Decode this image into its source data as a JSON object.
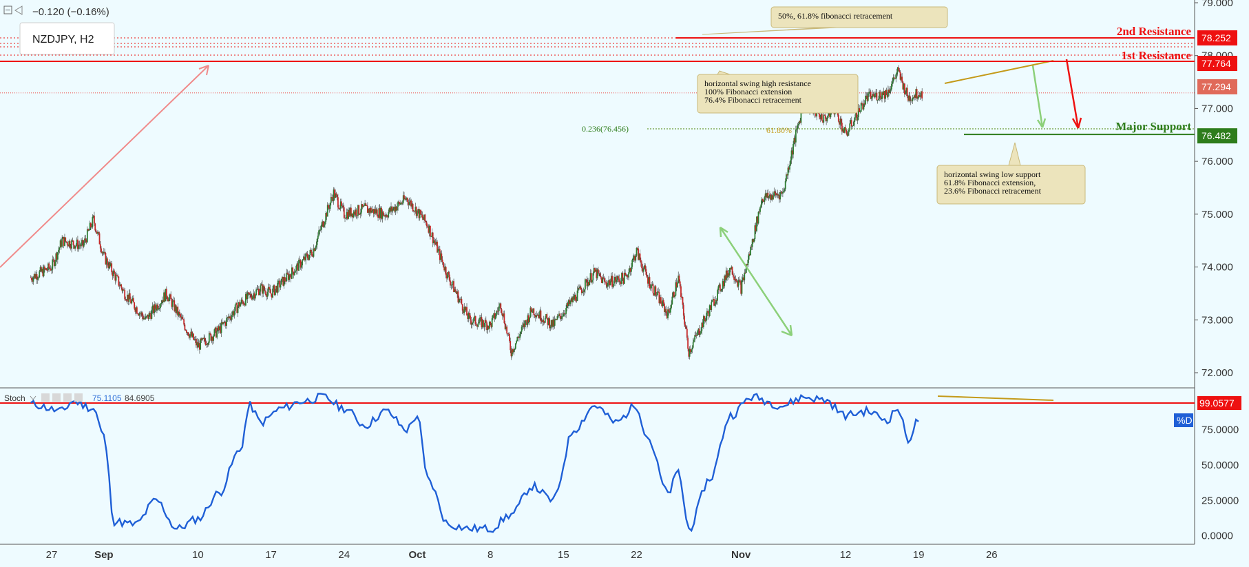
{
  "header": {
    "symbol": "NZDJPY, H2",
    "change": "−0.120 (−0.16%)"
  },
  "stochastic": {
    "title": "Stoch",
    "value_k": "75.1105",
    "value_d": "84.6905",
    "d_label": "%D",
    "level_label": "99.0577",
    "level_value": 99.0577
  },
  "annotations": {
    "fib_top": "50%, 61.8% fibonacci retracement",
    "swing_high": [
      "horizontal swing high resistance",
      "100% Fibonacci extension",
      "76.4% Fibonacci retracement"
    ],
    "swing_low": [
      "horizontal swing low support",
      "61.8% Fibonacci extension,",
      "23.6% Fibonacci retracement"
    ],
    "fib_236": "0.236(76.456)",
    "fib_618": "61.80%"
  },
  "levels": {
    "second_resistance": {
      "label": "2nd Resistance",
      "price": "78.252",
      "value": 78.252
    },
    "first_resistance": {
      "label": "1st Resistance",
      "price": "77.764",
      "value": 77.764
    },
    "current": {
      "price": "77.294",
      "value": 77.294
    },
    "major_support": {
      "label": "Major Support",
      "price": "76.482",
      "value": 76.482
    }
  },
  "colors": {
    "background": "#eefbff",
    "resistance": "#ee1111",
    "support": "#2e7d1c",
    "candle_up": "#2e7d32",
    "candle_down": "#c62828",
    "stoch_line": "#1f5fd6",
    "annotation_fill": "#ece4bc",
    "trend_arrow": "#f08a8a",
    "green_arrow": "#8cd07a",
    "gold_line": "#c49a1a"
  },
  "chart_data": {
    "type": "candlestick",
    "symbol": "NZDJPY",
    "timeframe": "H2",
    "y_ticks": [
      "72.000",
      "73.000",
      "74.000",
      "75.000",
      "76.000",
      "77.000",
      "78.000",
      "79.000"
    ],
    "ylim": [
      71.7,
      79.0
    ],
    "x_ticks": [
      "27",
      "Sep",
      "10",
      "17",
      "24",
      "Oct",
      "8",
      "15",
      "22",
      "Nov",
      "12",
      "19",
      "26"
    ],
    "x_tick_days": [
      0,
      5,
      14,
      21,
      28,
      35,
      42,
      49,
      56,
      66,
      76,
      83,
      90
    ],
    "close_path": [
      {
        "day": -2,
        "close": 73.8
      },
      {
        "day": 0,
        "close": 74.0
      },
      {
        "day": 1,
        "close": 74.5
      },
      {
        "day": 3,
        "close": 74.4
      },
      {
        "day": 4,
        "close": 74.9
      },
      {
        "day": 5,
        "close": 74.2
      },
      {
        "day": 7,
        "close": 73.5
      },
      {
        "day": 9,
        "close": 73.0
      },
      {
        "day": 11,
        "close": 73.5
      },
      {
        "day": 13,
        "close": 72.8
      },
      {
        "day": 14,
        "close": 72.5
      },
      {
        "day": 16,
        "close": 72.8
      },
      {
        "day": 18,
        "close": 73.3
      },
      {
        "day": 20,
        "close": 73.6
      },
      {
        "day": 21,
        "close": 73.5
      },
      {
        "day": 23,
        "close": 73.9
      },
      {
        "day": 25,
        "close": 74.3
      },
      {
        "day": 27,
        "close": 75.4
      },
      {
        "day": 28,
        "close": 75.0
      },
      {
        "day": 30,
        "close": 75.1
      },
      {
        "day": 32,
        "close": 75.0
      },
      {
        "day": 34,
        "close": 75.3
      },
      {
        "day": 36,
        "close": 74.8
      },
      {
        "day": 38,
        "close": 73.8
      },
      {
        "day": 40,
        "close": 73.0
      },
      {
        "day": 42,
        "close": 72.9
      },
      {
        "day": 43,
        "close": 73.3
      },
      {
        "day": 44,
        "close": 72.4
      },
      {
        "day": 46,
        "close": 73.2
      },
      {
        "day": 48,
        "close": 72.9
      },
      {
        "day": 50,
        "close": 73.4
      },
      {
        "day": 52,
        "close": 73.9
      },
      {
        "day": 53,
        "close": 73.7
      },
      {
        "day": 55,
        "close": 73.8
      },
      {
        "day": 56,
        "close": 74.3
      },
      {
        "day": 57,
        "close": 73.8
      },
      {
        "day": 59,
        "close": 73.1
      },
      {
        "day": 60,
        "close": 73.8
      },
      {
        "day": 61,
        "close": 72.4
      },
      {
        "day": 63,
        "close": 73.2
      },
      {
        "day": 65,
        "close": 74.0
      },
      {
        "day": 66,
        "close": 73.6
      },
      {
        "day": 67,
        "close": 74.4
      },
      {
        "day": 68,
        "close": 75.3
      },
      {
        "day": 70,
        "close": 75.4
      },
      {
        "day": 71,
        "close": 76.3
      },
      {
        "day": 72,
        "close": 77.1
      },
      {
        "day": 74,
        "close": 76.8
      },
      {
        "day": 75,
        "close": 77.0
      },
      {
        "day": 76,
        "close": 76.5
      },
      {
        "day": 78,
        "close": 77.2
      },
      {
        "day": 80,
        "close": 77.3
      },
      {
        "day": 81,
        "close": 77.7
      },
      {
        "day": 82,
        "close": 77.2
      },
      {
        "day": 83,
        "close": 77.294
      }
    ],
    "stochastic_k": [
      {
        "day": -2,
        "value": 93
      },
      {
        "day": 1,
        "value": 88
      },
      {
        "day": 2,
        "value": 95
      },
      {
        "day": 4,
        "value": 90
      },
      {
        "day": 5,
        "value": 70
      },
      {
        "day": 6,
        "value": 10
      },
      {
        "day": 8,
        "value": 8
      },
      {
        "day": 10,
        "value": 25
      },
      {
        "day": 12,
        "value": 5
      },
      {
        "day": 14,
        "value": 12
      },
      {
        "day": 16,
        "value": 30
      },
      {
        "day": 18,
        "value": 60
      },
      {
        "day": 19,
        "value": 92
      },
      {
        "day": 20,
        "value": 80
      },
      {
        "day": 22,
        "value": 90
      },
      {
        "day": 24,
        "value": 95
      },
      {
        "day": 26,
        "value": 98
      },
      {
        "day": 28,
        "value": 90
      },
      {
        "day": 30,
        "value": 78
      },
      {
        "day": 32,
        "value": 88
      },
      {
        "day": 34,
        "value": 75
      },
      {
        "day": 35,
        "value": 85
      },
      {
        "day": 36,
        "value": 40
      },
      {
        "day": 38,
        "value": 8
      },
      {
        "day": 40,
        "value": 5
      },
      {
        "day": 42,
        "value": 5
      },
      {
        "day": 44,
        "value": 15
      },
      {
        "day": 46,
        "value": 35
      },
      {
        "day": 48,
        "value": 25
      },
      {
        "day": 50,
        "value": 75
      },
      {
        "day": 52,
        "value": 92
      },
      {
        "day": 54,
        "value": 80
      },
      {
        "day": 56,
        "value": 92
      },
      {
        "day": 57,
        "value": 70
      },
      {
        "day": 59,
        "value": 30
      },
      {
        "day": 60,
        "value": 45
      },
      {
        "day": 61,
        "value": 5
      },
      {
        "day": 63,
        "value": 40
      },
      {
        "day": 65,
        "value": 85
      },
      {
        "day": 67,
        "value": 98
      },
      {
        "day": 70,
        "value": 92
      },
      {
        "day": 72,
        "value": 98
      },
      {
        "day": 74,
        "value": 96
      },
      {
        "day": 76,
        "value": 85
      },
      {
        "day": 78,
        "value": 88
      },
      {
        "day": 80,
        "value": 82
      },
      {
        "day": 81,
        "value": 90
      },
      {
        "day": 82,
        "value": 68
      },
      {
        "day": 83,
        "value": 82
      }
    ],
    "stoch_ticks": [
      "0.0000",
      "25.0000",
      "50.0000",
      "75.0000"
    ],
    "stoch_ylim": [
      -5,
      103
    ]
  }
}
